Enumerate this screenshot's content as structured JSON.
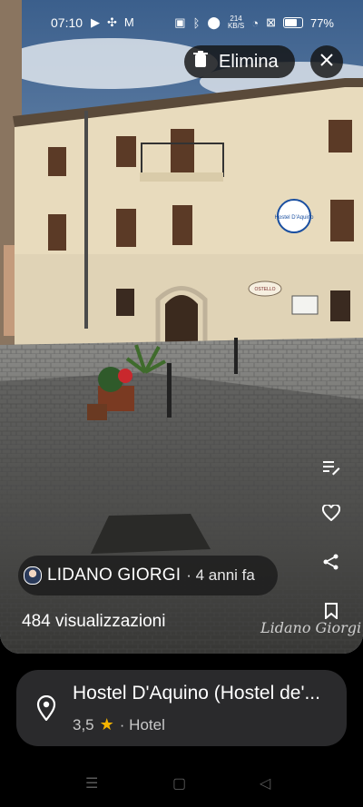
{
  "status_bar": {
    "time": "07:10",
    "net_speed_value": "214",
    "net_speed_unit": "KB/S",
    "battery": "77%"
  },
  "top_actions": {
    "delete_label": "Elimina"
  },
  "photo": {
    "sign_text_hostel": "Hostel D'Aquino",
    "sign_text_ostello": "OSTELLO"
  },
  "author": {
    "name": "LIDANO GIORGI",
    "time": "· 4 anni fa"
  },
  "views": "484 visualizzazioni",
  "watermark": "Lidano Giorgi",
  "place": {
    "title": "Hostel D'Aquino (Hostel de'...",
    "rating": "3,5",
    "category": "· Hotel"
  },
  "colors": {
    "card_bg": "#2a2a2c",
    "star": "#f5b400"
  }
}
